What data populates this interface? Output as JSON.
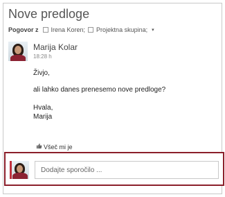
{
  "thread": {
    "title": "Nove predloge",
    "conversation_label": "Pogovor z",
    "participants": [
      {
        "name": "Irena Koren;"
      },
      {
        "name": "Projektna skupina;"
      }
    ],
    "more_icon": "chevron-down"
  },
  "message": {
    "author": "Marija Kolar",
    "time": "18:28 h",
    "lines": [
      "Živjo,",
      "ali lahko danes prenesemo nove predloge?",
      "Hvala,",
      "Marija"
    ],
    "like_label": "Všeč mi je"
  },
  "compose": {
    "placeholder": "Dodajte sporočilo ..."
  },
  "colors": {
    "accent": "#8b1f2a",
    "border": "#c8c8c8"
  }
}
